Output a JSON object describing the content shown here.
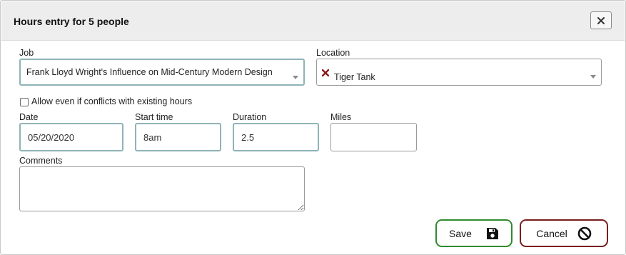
{
  "dialog": {
    "title": "Hours entry for 5 people",
    "close_icon": "close-icon"
  },
  "form": {
    "job": {
      "label": "Job",
      "selected": "Frank Lloyd Wright's Influence on Mid-Century Modern Design",
      "icon": "chevron-down-icon"
    },
    "location": {
      "label": "Location",
      "selected": "Tiger Tank",
      "clear_icon": "remove-icon",
      "clear_color": "#8b1a1a"
    },
    "allow_conflicts": {
      "label": "Allow even if conflicts with existing hours",
      "checked": false
    },
    "date": {
      "label": "Date",
      "value": "05/20/2020"
    },
    "start_time": {
      "label": "Start time",
      "value": "8am"
    },
    "duration": {
      "label": "Duration",
      "value": "2.5"
    },
    "miles": {
      "label": "Miles",
      "value": ""
    },
    "comments": {
      "label": "Comments",
      "value": ""
    }
  },
  "buttons": {
    "save": {
      "label": "Save",
      "icon": "floppy-disk-icon",
      "color": "#2f8a2f"
    },
    "cancel": {
      "label": "Cancel",
      "icon": "prohibited-icon",
      "color": "#7a1e1e"
    }
  }
}
